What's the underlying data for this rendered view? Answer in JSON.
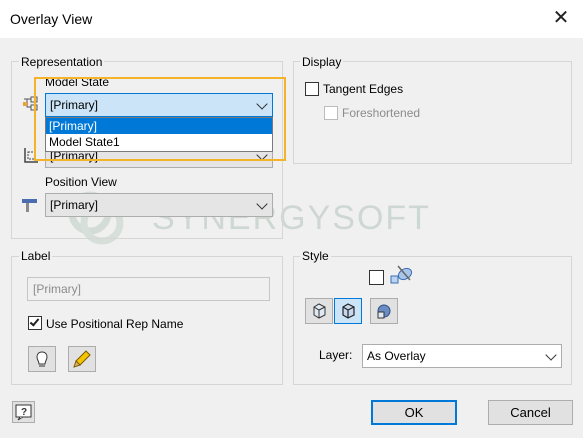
{
  "window": {
    "title": "Overlay View"
  },
  "representation": {
    "group_label": "Representation",
    "model_state_label": "Model State",
    "model_state_value": "[Primary]",
    "dropdown_options": [
      "[Primary]",
      "Model State1"
    ],
    "design_view_value": "[Primary]",
    "position_view_label": "Position View",
    "position_view_value": "[Primary]"
  },
  "display": {
    "group_label": "Display",
    "tangent_edges_label": "Tangent Edges",
    "foreshortened_label": "Foreshortened"
  },
  "label": {
    "group_label": "Label",
    "text_value": "[Primary]",
    "use_positional_label": "Use Positional Rep Name"
  },
  "style": {
    "group_label": "Style",
    "layer_label": "Layer:",
    "layer_value": "As Overlay"
  },
  "buttons": {
    "ok": "OK",
    "cancel": "Cancel"
  },
  "watermark": "SYNERGYSOFT",
  "colors": {
    "accent": "#0078d7",
    "highlight": "#f5b32a",
    "selection": "#0078d7"
  }
}
